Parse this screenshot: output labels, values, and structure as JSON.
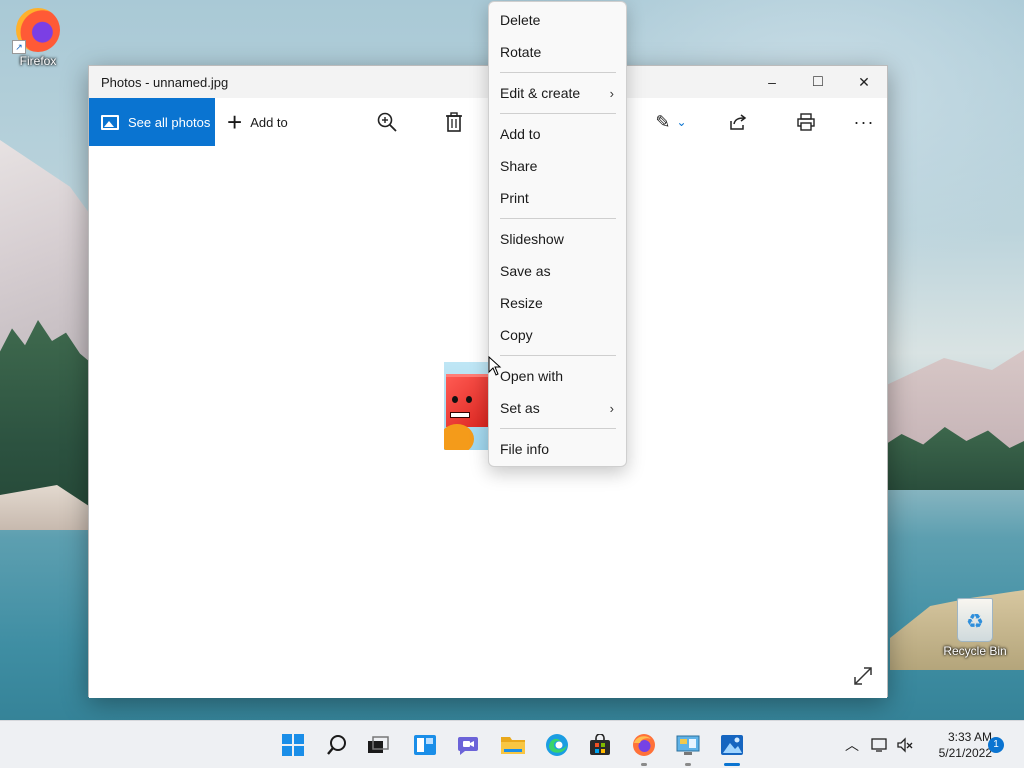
{
  "desktop": {
    "icons": [
      {
        "label": "Firefox",
        "icon": "firefox-icon"
      },
      {
        "label": "Recycle Bin",
        "icon": "recycle-bin-icon"
      }
    ]
  },
  "window": {
    "title": "Photos - unnamed.jpg",
    "controls": {
      "minimize": "–",
      "maximize": "□",
      "close": "✕"
    },
    "toolbar": {
      "see_all_label": "See all photos",
      "add_to_label": "Add to"
    }
  },
  "context_menu": {
    "items": [
      {
        "label": "Delete"
      },
      {
        "label": "Rotate"
      },
      {
        "label": "Edit & create",
        "submenu": true
      },
      {
        "label": "Add to"
      },
      {
        "label": "Share"
      },
      {
        "label": "Print"
      },
      {
        "label": "Slideshow"
      },
      {
        "label": "Save as"
      },
      {
        "label": "Resize"
      },
      {
        "label": "Copy"
      },
      {
        "label": "Open with"
      },
      {
        "label": "Set as",
        "submenu": true
      },
      {
        "label": "File info"
      }
    ],
    "chevron": "›"
  },
  "taskbar": {
    "apps": [
      "start-icon",
      "search-icon",
      "task-view-icon",
      "widgets-icon",
      "chat-icon",
      "file-explorer-icon",
      "edge-icon",
      "store-icon",
      "firefox-icon",
      "control-panel-icon",
      "photos-icon"
    ],
    "clock": {
      "time": "3:33 AM",
      "date": "5/21/2022"
    },
    "notification_count": "1"
  },
  "colors": {
    "accent": "#0a74d1",
    "menu_bg": "#f9f9f9",
    "taskbar_bg": "#eef0f3"
  }
}
